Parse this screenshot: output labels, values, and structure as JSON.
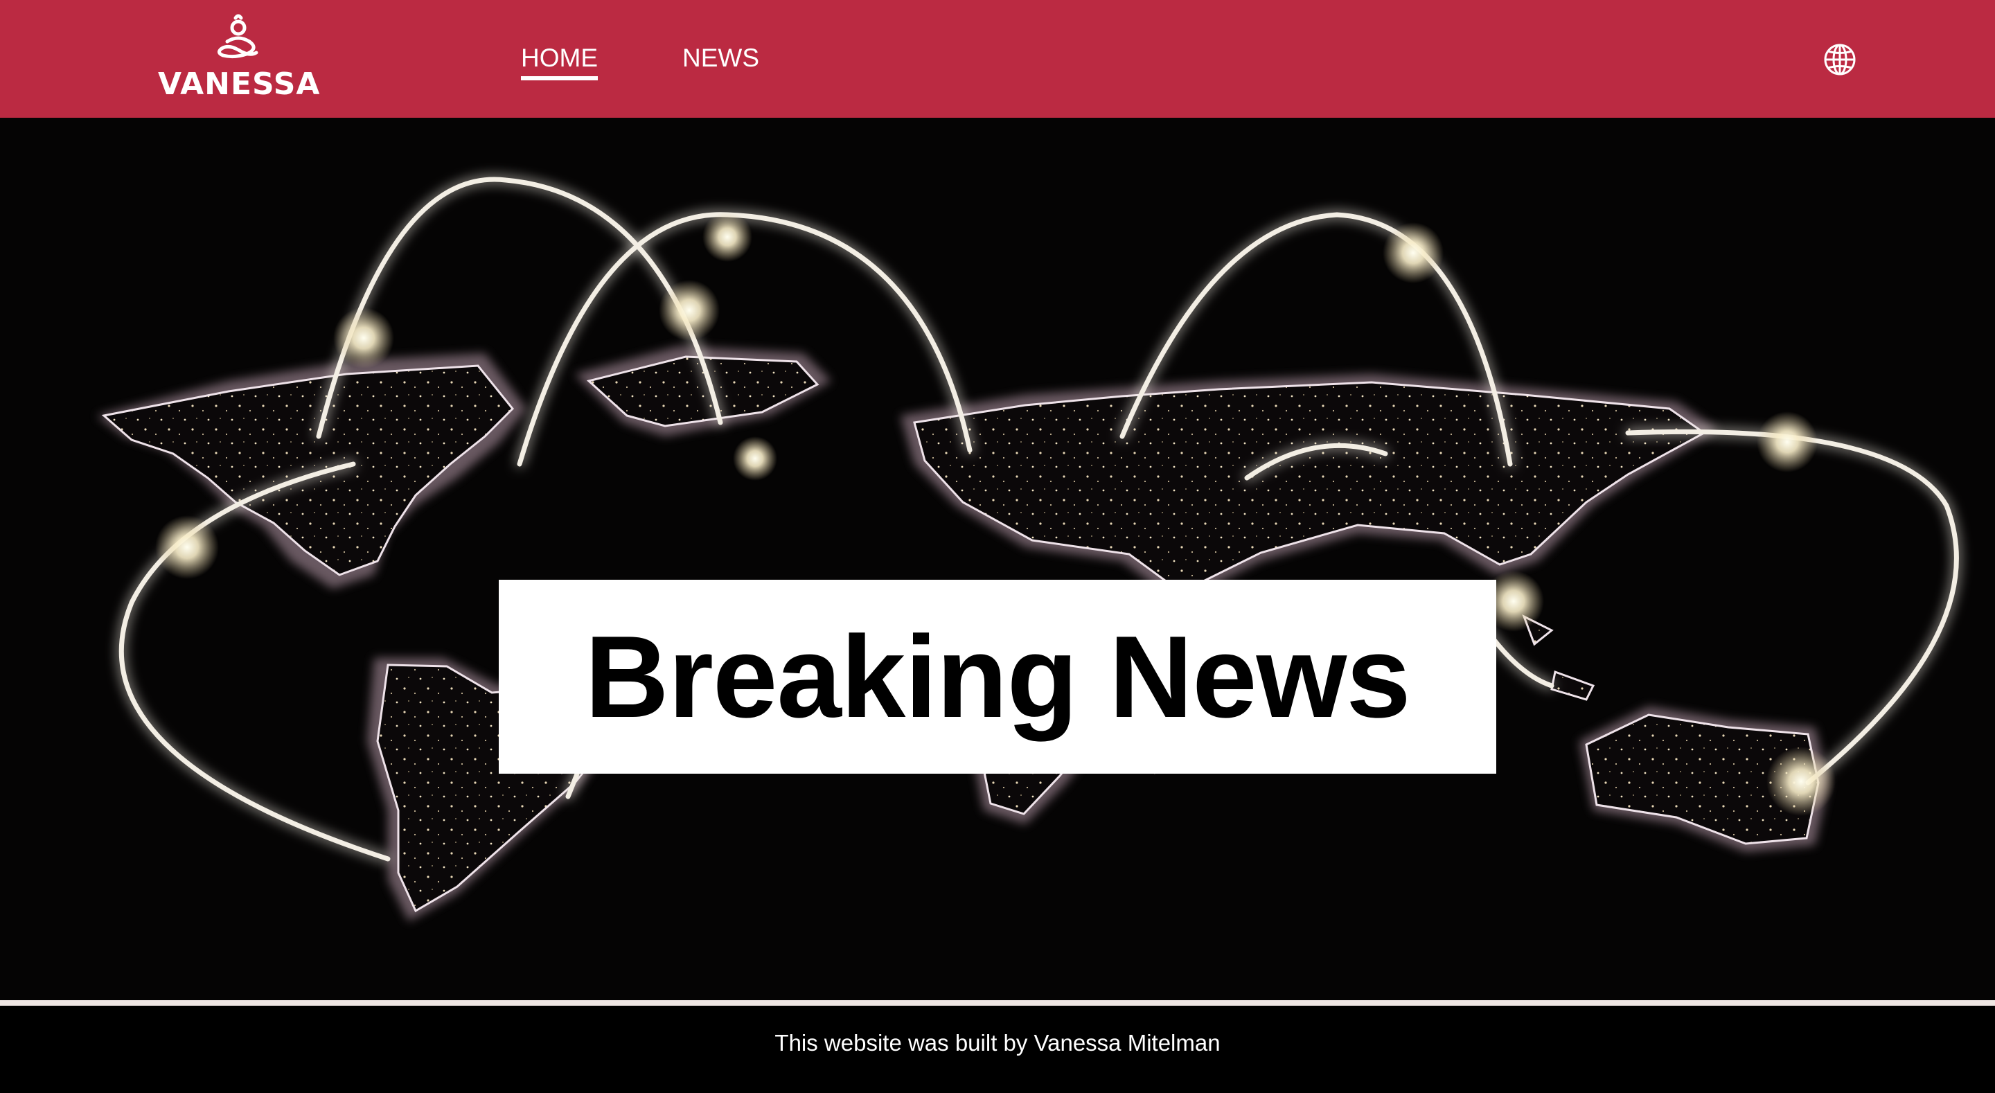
{
  "header": {
    "brand": "VANESSA",
    "logo_icon": "meditation-figure-icon",
    "nav": {
      "home": "HOME",
      "news": "NEWS"
    },
    "language_icon": "globe-icon"
  },
  "hero": {
    "headline": "Breaking News",
    "background_image": "world-map-network-connections"
  },
  "footer": {
    "credit": "This website was built by Vanessa Mitelman"
  },
  "colors": {
    "header_bg": "#bb2a42",
    "hero_bg": "#050404",
    "footer_bg": "#000000",
    "headline_box": "#ffffff"
  }
}
